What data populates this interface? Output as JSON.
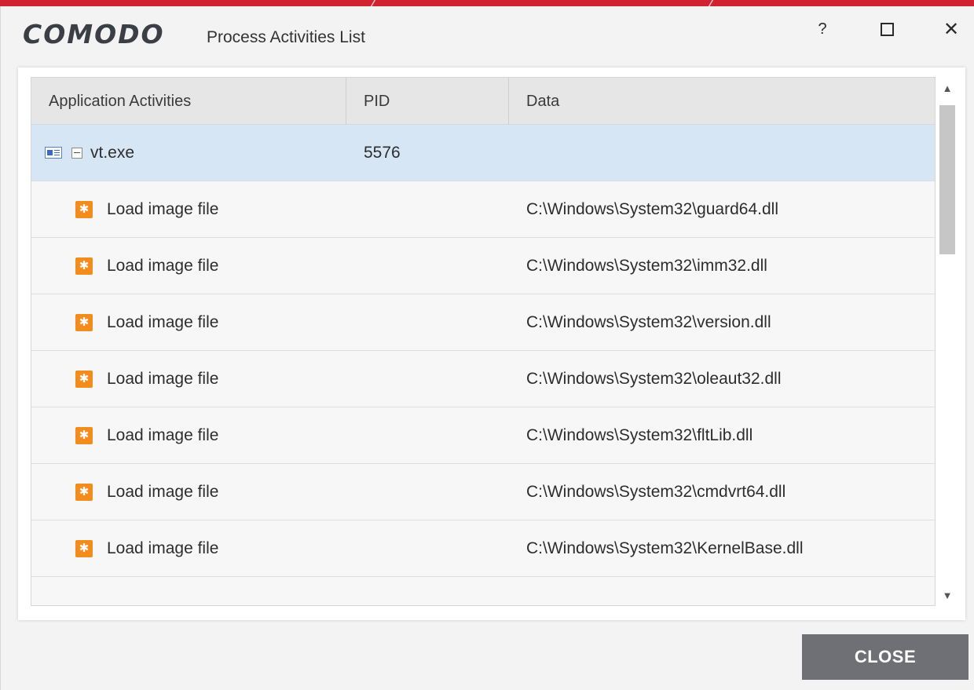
{
  "window": {
    "brand": "COMODO",
    "title": "Process Activities List",
    "help_symbol": "?",
    "close_symbol": "✕"
  },
  "table": {
    "columns": [
      "Application Activities",
      "PID",
      "Data"
    ],
    "process": {
      "name": "vt.exe",
      "pid": "5576"
    },
    "rows": [
      {
        "activity": "Load image file",
        "data": "C:\\Windows\\System32\\guard64.dll"
      },
      {
        "activity": "Load image file",
        "data": "C:\\Windows\\System32\\imm32.dll"
      },
      {
        "activity": "Load image file",
        "data": "C:\\Windows\\System32\\version.dll"
      },
      {
        "activity": "Load image file",
        "data": "C:\\Windows\\System32\\oleaut32.dll"
      },
      {
        "activity": "Load image file",
        "data": "C:\\Windows\\System32\\fltLib.dll"
      },
      {
        "activity": "Load image file",
        "data": "C:\\Windows\\System32\\cmdvrt64.dll"
      },
      {
        "activity": "Load image file",
        "data": "C:\\Windows\\System32\\KernelBase.dll"
      }
    ]
  },
  "footer": {
    "close_label": "CLOSE"
  },
  "colors": {
    "accent_red": "#d0222f",
    "selected_row": "#d6e6f5",
    "activity_icon": "#f28c1c",
    "close_button": "#6e7075"
  },
  "icons": {
    "process": "process-window-icon",
    "collapse": "collapse-minus-icon",
    "activity": "gear-activity-icon"
  }
}
